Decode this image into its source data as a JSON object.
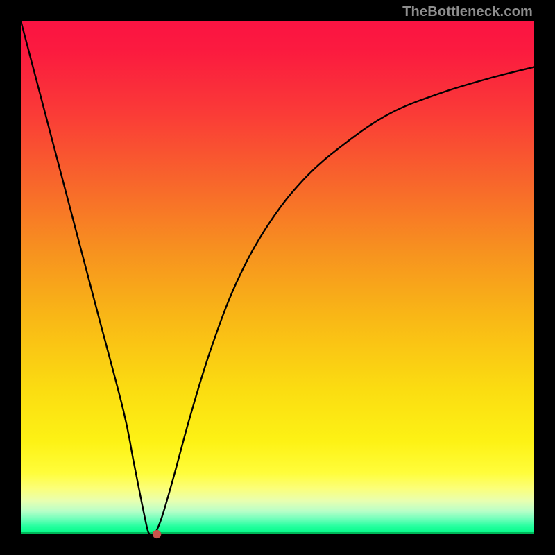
{
  "watermark": "TheBottleneck.com",
  "chart_data": {
    "type": "line",
    "title": "",
    "xlabel": "",
    "ylabel": "",
    "xlim": [
      0,
      100
    ],
    "ylim": [
      0,
      100
    ],
    "grid": false,
    "legend": false,
    "series": [
      {
        "name": "curve",
        "x": [
          0,
          5,
          10,
          15,
          20,
          22,
          24,
          25,
          26,
          27,
          28,
          30,
          33,
          37,
          42,
          48,
          55,
          63,
          72,
          82,
          92,
          100
        ],
        "values": [
          100,
          81,
          62,
          43,
          24,
          14,
          4,
          0,
          0,
          2,
          5,
          12,
          23,
          36,
          49,
          60,
          69,
          76,
          82,
          86,
          89,
          91
        ]
      }
    ],
    "marker": {
      "x": 26.5,
      "y": 0,
      "color": "#c9544b",
      "r": 6
    },
    "gradient_stops": [
      {
        "pos": 0,
        "color": "#fb1342"
      },
      {
        "pos": 0.45,
        "color": "#f7921f"
      },
      {
        "pos": 0.8,
        "color": "#fbe812"
      },
      {
        "pos": 0.95,
        "color": "#beffb8"
      },
      {
        "pos": 1.0,
        "color": "#00fb86"
      }
    ]
  }
}
